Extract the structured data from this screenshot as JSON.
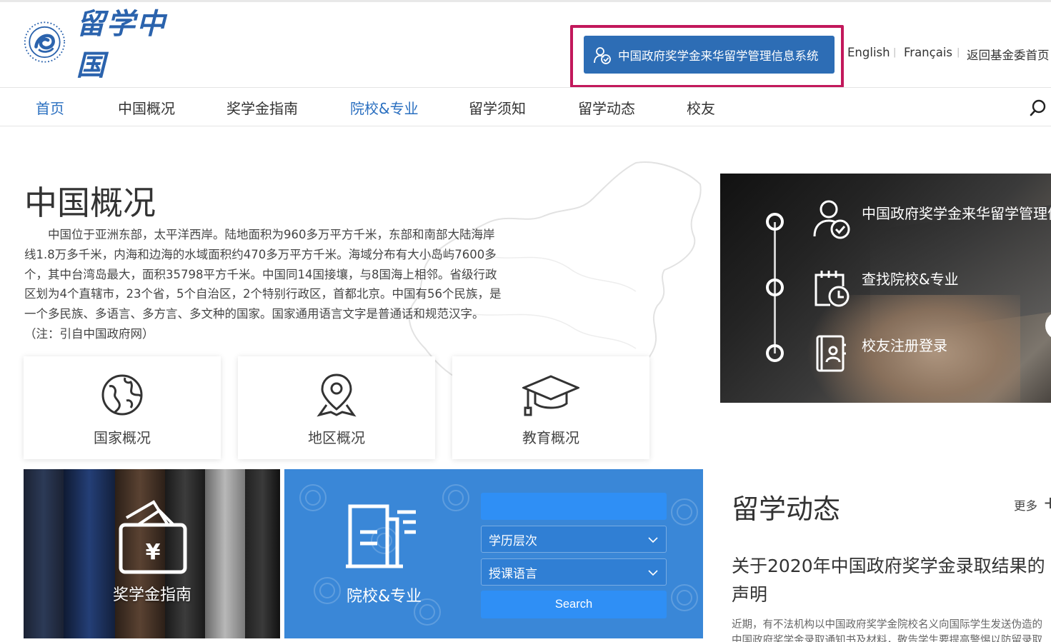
{
  "header": {
    "logo_alt": "留学中国",
    "system_button": "中国政府奖学金来华留学管理信息系统",
    "languages": [
      "English",
      "Français",
      "返回基金委首页"
    ]
  },
  "nav": {
    "items": [
      "首页",
      "中国概况",
      "奖学金指南",
      "院校&专业",
      "留学须知",
      "留学动态",
      "校友"
    ],
    "active": "首页"
  },
  "overview": {
    "title": "中国概况",
    "text": "中国位于亚洲东部，太平洋西岸。陆地面积为960多万平方千米，东部和南部大陆海岸线1.8万多千米，内海和边海的水域面积约470多万平方千米。海域分布有大小岛屿7600多个，其中台湾岛最大，面积35798平方千米。中国同14国接壤，与8国海上相邻。省级行政区划为4个直辖市，23个省，5个自治区，2个特别行政区，首都北京。中国有56个民族，是一个多民族、多语言、多方言、多文种的国家。国家通用语言文字是普通话和规范汉字。（注：引自中国政府网）",
    "cards": [
      "国家概况",
      "地区概况",
      "教育概况"
    ]
  },
  "panel": {
    "items": [
      "中国政府奖学金来华留学管理信息系统",
      "查找院校&专业",
      "校友注册登录"
    ]
  },
  "tiles": {
    "scholarship": "奖学金指南",
    "institutions": "院校&专业",
    "select_degree": "学历层次",
    "select_language": "授课语言",
    "search": "Search"
  },
  "news": {
    "title": "留学动态",
    "more": "更多",
    "headline": "关于2020年中国政府奖学金录取结果的声明",
    "summary": "近期，有不法机构以中国政府奖学金院校名义向国际学生发送伪造的中国政府奖学金录取通知书及材料，敬告学生要提高警惕以防留录取资格。"
  },
  "colors": {
    "brand_blue": "#2d6db5",
    "nav_active": "#2a6fc0",
    "tile_blue": "#3a87d7",
    "highlight": "#c2185b"
  }
}
